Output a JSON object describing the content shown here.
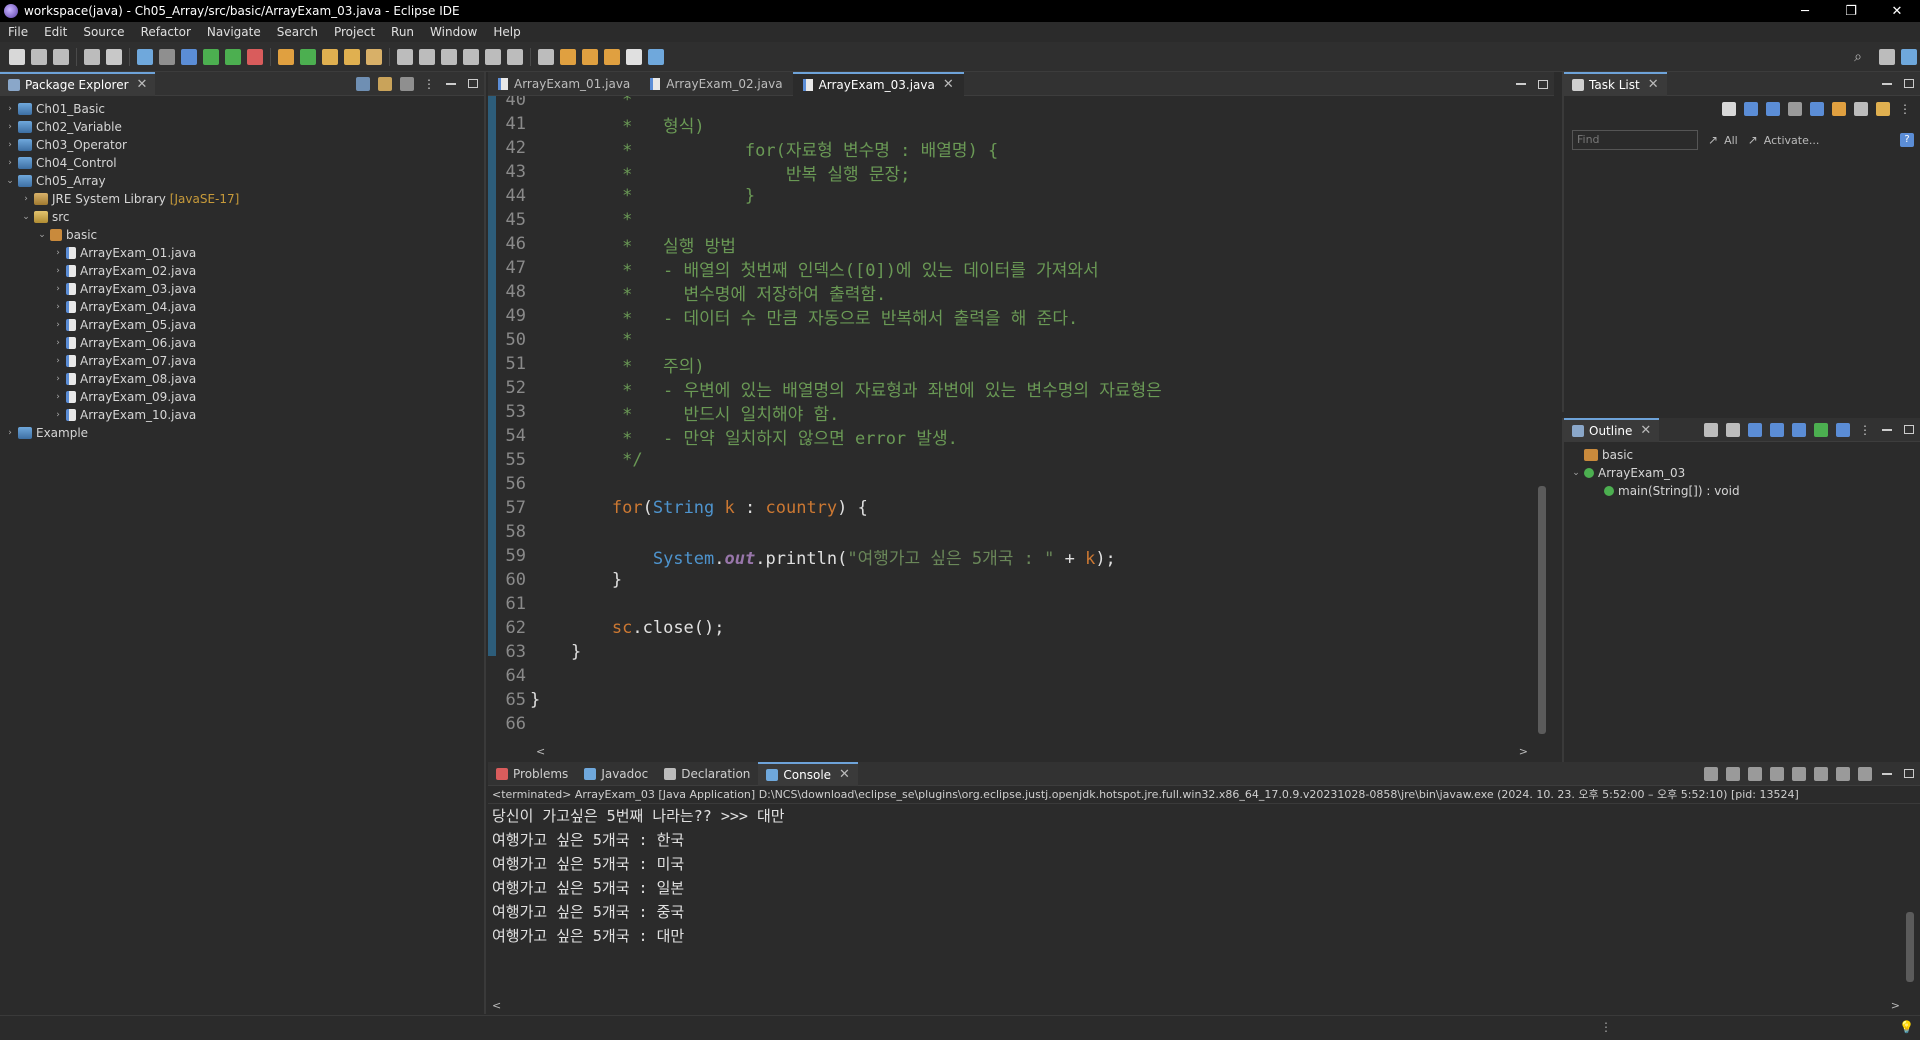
{
  "window": {
    "title": "workspace(java) - Ch05_Array/src/basic/ArrayExam_03.java - Eclipse IDE",
    "minimize": "─",
    "maximize": "❐",
    "close": "✕"
  },
  "menu": [
    "File",
    "Edit",
    "Source",
    "Refactor",
    "Navigate",
    "Search",
    "Project",
    "Run",
    "Window",
    "Help"
  ],
  "package_explorer": {
    "tab_label": "Package Explorer",
    "tree": [
      {
        "label": "Ch01_Basic",
        "type": "project",
        "expanded": false,
        "depth": 0
      },
      {
        "label": "Ch02_Variable",
        "type": "project",
        "expanded": false,
        "depth": 0
      },
      {
        "label": "Ch03_Operator",
        "type": "project",
        "expanded": false,
        "depth": 0
      },
      {
        "label": "Ch04_Control",
        "type": "project",
        "expanded": false,
        "depth": 0
      },
      {
        "label": "Ch05_Array",
        "type": "project",
        "expanded": true,
        "depth": 0
      },
      {
        "label": "JRE System Library",
        "suffix": "[JavaSE-17]",
        "type": "lib",
        "expanded": false,
        "depth": 1
      },
      {
        "label": "src",
        "type": "folder",
        "expanded": true,
        "depth": 1
      },
      {
        "label": "basic",
        "type": "pkg",
        "expanded": true,
        "depth": 2
      },
      {
        "label": "ArrayExam_01.java",
        "type": "java",
        "expanded": false,
        "depth": 3
      },
      {
        "label": "ArrayExam_02.java",
        "type": "java",
        "expanded": false,
        "depth": 3
      },
      {
        "label": "ArrayExam_03.java",
        "type": "java",
        "expanded": false,
        "depth": 3
      },
      {
        "label": "ArrayExam_04.java",
        "type": "java",
        "expanded": false,
        "depth": 3
      },
      {
        "label": "ArrayExam_05.java",
        "type": "java",
        "expanded": false,
        "depth": 3
      },
      {
        "label": "ArrayExam_06.java",
        "type": "java",
        "expanded": false,
        "depth": 3
      },
      {
        "label": "ArrayExam_07.java",
        "type": "java",
        "expanded": false,
        "depth": 3
      },
      {
        "label": "ArrayExam_08.java",
        "type": "java",
        "expanded": false,
        "depth": 3
      },
      {
        "label": "ArrayExam_09.java",
        "type": "java",
        "expanded": false,
        "depth": 3
      },
      {
        "label": "ArrayExam_10.java",
        "type": "java",
        "expanded": false,
        "depth": 3
      },
      {
        "label": "Example",
        "type": "project",
        "expanded": false,
        "depth": 0
      }
    ]
  },
  "editor": {
    "tabs": [
      {
        "label": "ArrayExam_01.java",
        "active": false
      },
      {
        "label": "ArrayExam_02.java",
        "active": false
      },
      {
        "label": "ArrayExam_03.java",
        "active": true
      }
    ],
    "lines": [
      {
        "n": "40",
        "parts": [
          [
            "cm",
            "         *"
          ]
        ]
      },
      {
        "n": "41",
        "parts": [
          [
            "cm",
            "         *   형식)"
          ]
        ]
      },
      {
        "n": "42",
        "parts": [
          [
            "cm",
            "         *           for(자료형 변수명 : 배열명) {"
          ]
        ]
      },
      {
        "n": "43",
        "parts": [
          [
            "cm",
            "         *               반복 실행 문장;"
          ]
        ]
      },
      {
        "n": "44",
        "parts": [
          [
            "cm",
            "         *           }"
          ]
        ]
      },
      {
        "n": "45",
        "parts": [
          [
            "cm",
            "         *"
          ]
        ]
      },
      {
        "n": "46",
        "parts": [
          [
            "cm",
            "         *   실행 방법"
          ]
        ]
      },
      {
        "n": "47",
        "parts": [
          [
            "cm",
            "         *   - 배열의 첫번째 인덱스([0])에 있는 데이터를 가져와서"
          ]
        ]
      },
      {
        "n": "48",
        "parts": [
          [
            "cm",
            "         *     변수명에 저장하여 출력함."
          ]
        ]
      },
      {
        "n": "49",
        "parts": [
          [
            "cm",
            "         *   - 데이터 수 만큼 자동으로 반복해서 출력을 해 준다."
          ]
        ]
      },
      {
        "n": "50",
        "parts": [
          [
            "cm",
            "         *"
          ]
        ]
      },
      {
        "n": "51",
        "parts": [
          [
            "cm",
            "         *   주의)"
          ]
        ]
      },
      {
        "n": "52",
        "parts": [
          [
            "cm",
            "         *   - 우변에 있는 배열명의 자료형과 좌변에 있는 변수명의 자료형은"
          ]
        ]
      },
      {
        "n": "53",
        "parts": [
          [
            "cm",
            "         *     반드시 일치해야 함."
          ]
        ]
      },
      {
        "n": "54",
        "parts": [
          [
            "cm",
            "         *   - 만약 일치하지 않으면 error 발생."
          ]
        ]
      },
      {
        "n": "55",
        "parts": [
          [
            "cm",
            "         */"
          ]
        ]
      },
      {
        "n": "56",
        "parts": []
      },
      {
        "n": "57",
        "parts": [
          [
            "tx",
            "        "
          ],
          [
            "kw",
            "for"
          ],
          [
            "tx",
            "("
          ],
          [
            "ty",
            "String"
          ],
          [
            "tx",
            " "
          ],
          [
            "kw",
            "k"
          ],
          [
            "tx",
            " : "
          ],
          [
            "kw",
            "country"
          ],
          [
            "tx",
            ") {"
          ]
        ]
      },
      {
        "n": "58",
        "parts": []
      },
      {
        "n": "59",
        "parts": [
          [
            "tx",
            "            "
          ],
          [
            "ty",
            "System"
          ],
          [
            "tx",
            "."
          ],
          [
            "fld",
            "out"
          ],
          [
            "tx",
            ".println("
          ],
          [
            "st",
            "\"여행가고 싶은 5개국 : \""
          ],
          [
            "tx",
            " + "
          ],
          [
            "kw",
            "k"
          ],
          [
            "tx",
            ");"
          ]
        ]
      },
      {
        "n": "60",
        "parts": [
          [
            "tx",
            "        }"
          ]
        ]
      },
      {
        "n": "61",
        "parts": []
      },
      {
        "n": "62",
        "parts": [
          [
            "tx",
            "        "
          ],
          [
            "kw",
            "sc"
          ],
          [
            "tx",
            ".close();"
          ]
        ]
      },
      {
        "n": "63",
        "parts": [
          [
            "tx",
            "    }"
          ]
        ]
      },
      {
        "n": "64",
        "parts": []
      },
      {
        "n": "65",
        "parts": [
          [
            "tx",
            "}"
          ]
        ]
      },
      {
        "n": "66",
        "parts": []
      }
    ],
    "hscroll_left": "<",
    "hscroll_right": ">"
  },
  "task_list": {
    "tab_label": "Task List",
    "find_placeholder": "Find",
    "all_label": "All",
    "activate_label": "Activate..."
  },
  "outline": {
    "tab_label": "Outline",
    "items": [
      {
        "label": "basic",
        "depth": 0
      },
      {
        "label": "ArrayExam_03",
        "depth": 0
      },
      {
        "label": "main(String[]) : void",
        "depth": 1
      }
    ]
  },
  "bottom": {
    "tabs": [
      {
        "label": "Problems",
        "active": false
      },
      {
        "label": "Javadoc",
        "active": false
      },
      {
        "label": "Declaration",
        "active": false
      },
      {
        "label": "Console",
        "active": true
      }
    ],
    "status_line": "<terminated> ArrayExam_03 [Java Application] D:\\NCS\\download\\eclipse_se\\plugins\\org.eclipse.justj.openjdk.hotspot.jre.full.win32.x86_64_17.0.9.v20231028-0858\\jre\\bin\\javaw.exe  (2024. 10. 23. 오후 5:52:00 – 오후 5:52:10) [pid: 13524]",
    "console_lines": [
      "당신이 가고싶은 5번째 나라는?? >>> 대만",
      "여행가고 싶은 5개국 : 한국",
      "여행가고 싶은 5개국 : 미국",
      "여행가고 싶은 5개국 : 일본",
      "여행가고 싶은 5개국 : 중국",
      "여행가고 싶은 5개국 : 대만"
    ]
  },
  "colors": {
    "accent": "#6ea3d9",
    "comment": "#6a9955",
    "keyword": "#cc7832",
    "type": "#4e94ce"
  }
}
